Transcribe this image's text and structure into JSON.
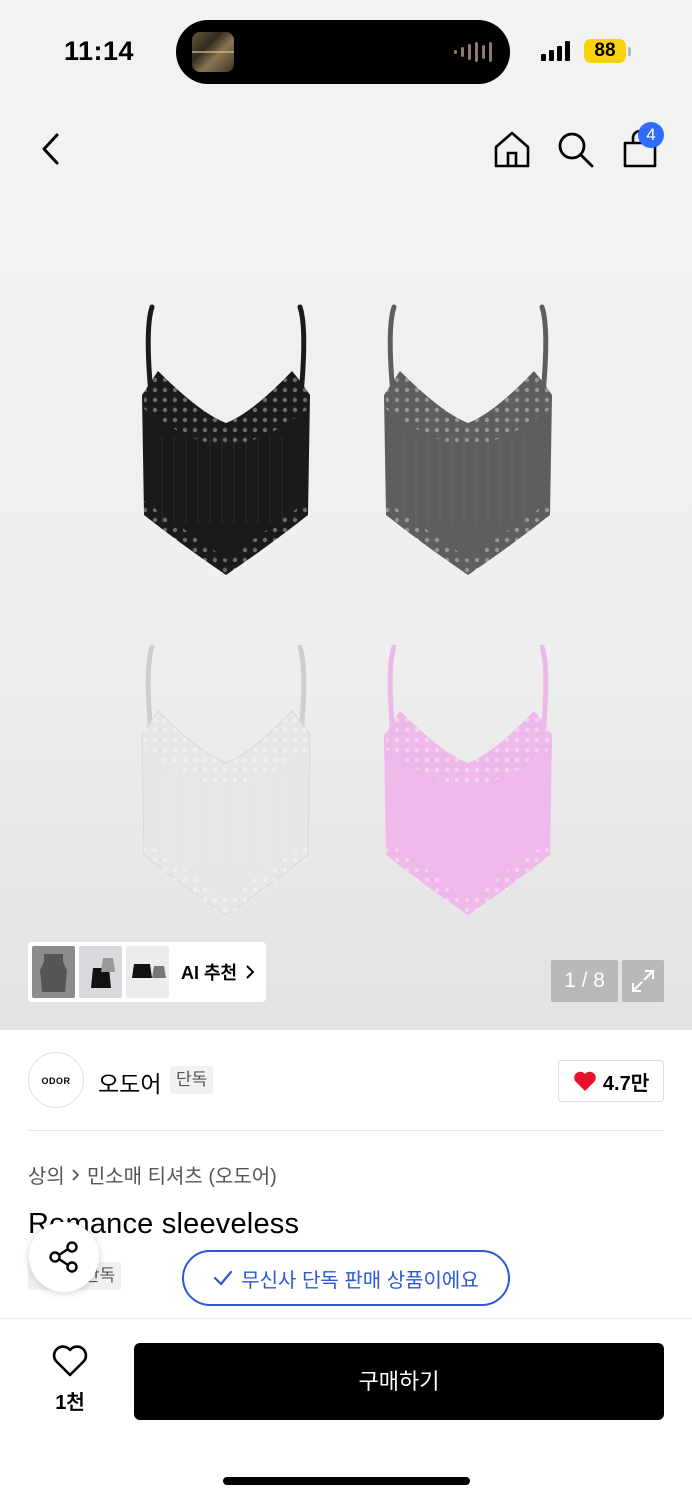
{
  "status_bar": {
    "time": "11:14",
    "battery": "88"
  },
  "nav": {
    "cart_count": "4"
  },
  "gallery": {
    "ai_label": "AI 추천",
    "page_counter": "1 / 8",
    "variant_colors": [
      "#1a1a1a",
      "#5e5e5e",
      "#e6e6e6",
      "#efb8ea"
    ]
  },
  "brand": {
    "name": "오도어",
    "logo_text": "ODOR",
    "tag": "단독",
    "likes": "4.7만"
  },
  "breadcrumb": {
    "category": "상의",
    "sub": "민소매 티셔츠 (오도어)"
  },
  "product": {
    "title": "Romance sleeveless",
    "tag": "단독",
    "exclusive_notice": "무신사 단독 판매 상품이에요"
  },
  "bottom": {
    "wish_count": "1천",
    "buy_label": "구매하기"
  },
  "colors": {
    "accent_blue": "#2e57d6",
    "badge_blue": "#2e6bff",
    "heart_red": "#e8112d",
    "battery_yellow": "#f9d20a"
  }
}
